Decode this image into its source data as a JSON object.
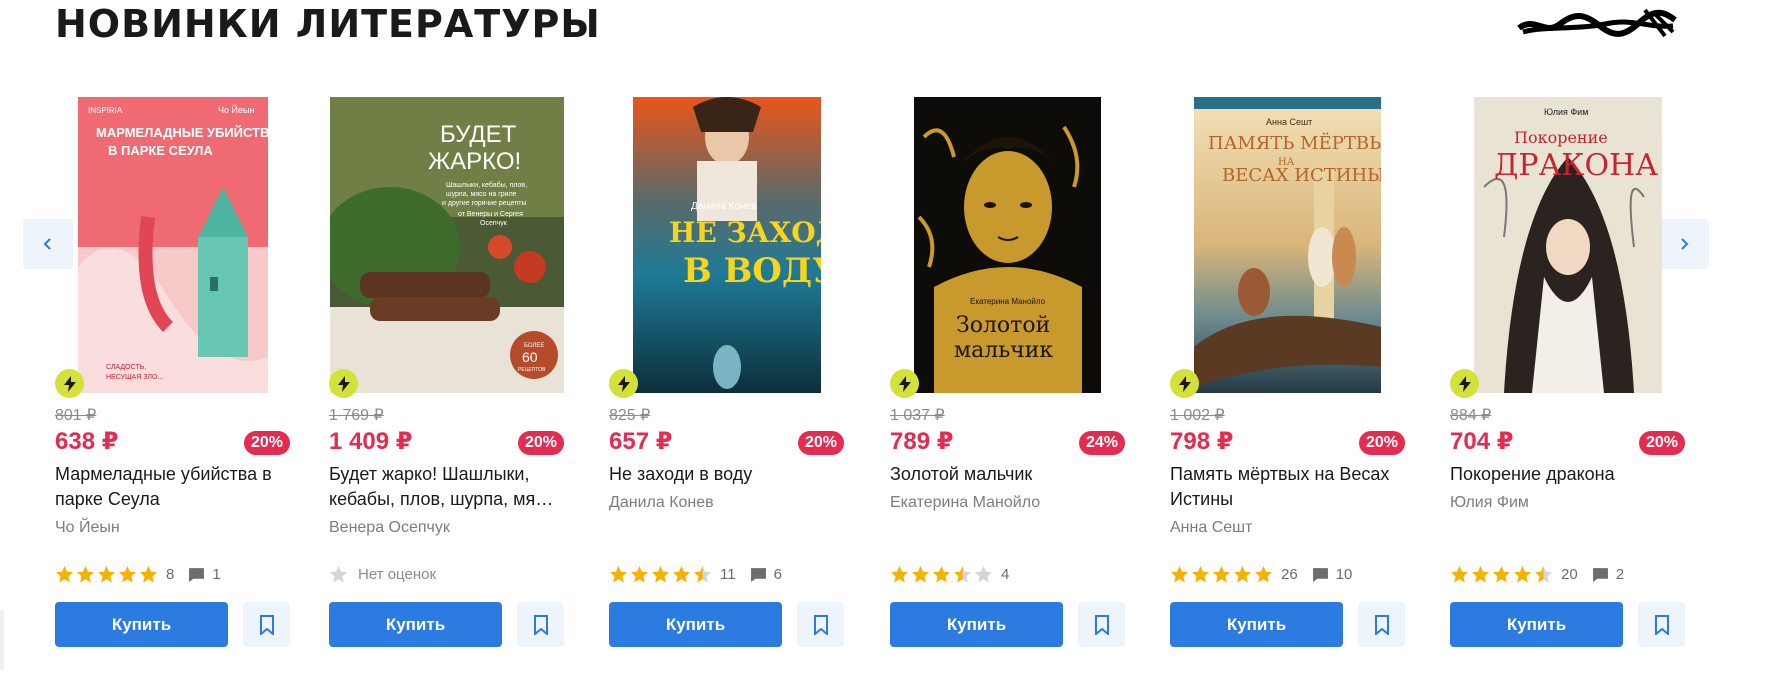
{
  "section": {
    "title": "НОВИНКИ ЛИТЕРАТУРЫ"
  },
  "colors": {
    "price": "#e52b50",
    "buy": "#2c7be0",
    "bolt": "#d3e13a",
    "star": "#f5b301"
  },
  "nav": {
    "prev_icon": "chevron-left-icon",
    "next_icon": "chevron-right-icon"
  },
  "books": [
    {
      "old_price": "801 ₽",
      "price": "638 ₽",
      "discount": "20%",
      "title": "Мармеладные убийства в парке Сеула",
      "author": "Чо Йеын",
      "stars": 5,
      "rating_count": "8",
      "comments": "1",
      "cover": {
        "brand": "INSPIRIA",
        "author": "Чо Йеын",
        "title1": "МАРМЕЛАДНЫЕ УБИЙСТВА",
        "title2": "В ПАРКЕ СЕУЛА",
        "tag1": "СЛАДОСТЬ,",
        "tag2": "НЕСУЩАЯ ЗЛО..."
      },
      "buy_label": "Купить"
    },
    {
      "old_price": "1 769 ₽",
      "price": "1 409 ₽",
      "discount": "20%",
      "title": "Будет жарко! Шашлыки, кебабы, плов, шурпа, мясо на гриле",
      "author": "Венера Осепчук",
      "stars": 0,
      "no_rating": "Нет оценок",
      "cover": {
        "title1": "БУДЕТ",
        "title2": "ЖАРКО!",
        "sub1": "Шашлыки, кебабы, плов,",
        "sub2": "шурпа, мясо на гриле",
        "sub3": "и другие горячие рецепты",
        "sub4": "от Венеры и Сергея",
        "sub5": "Осепчук",
        "badge1": "БОЛЕЕ",
        "badge2": "60",
        "badge3": "РЕЦЕПТОВ"
      },
      "buy_label": "Купить"
    },
    {
      "old_price": "825 ₽",
      "price": "657 ₽",
      "discount": "20%",
      "title": "Не заходи в воду",
      "author": "Данила Конев",
      "stars": 4.5,
      "rating_count": "11",
      "comments": "6",
      "cover": {
        "author": "Данила Конев",
        "title1": "НЕ ЗАХОДИ",
        "title2": "В ВОДУ"
      },
      "buy_label": "Купить"
    },
    {
      "old_price": "1 037 ₽",
      "price": "789 ₽",
      "discount": "24%",
      "title": "Золотой мальчик",
      "author": "Екатерина Манойло",
      "stars": 3.5,
      "rating_count": "4",
      "cover": {
        "author": "Екатерина Манойло",
        "title1": "Золотой",
        "title2": "мальчик"
      },
      "buy_label": "Купить"
    },
    {
      "old_price": "1 002 ₽",
      "price": "798 ₽",
      "discount": "20%",
      "title": "Память мёртвых на Весах Истины",
      "author": "Анна Сешт",
      "stars": 5,
      "rating_count": "26",
      "comments": "10",
      "cover": {
        "author": "Анна Сешт",
        "title1": "ПАМЯТЬ МЁРТВЫХ",
        "title2": "НА",
        "title3": "ВЕСАХ ИСТИНЫ"
      },
      "buy_label": "Купить"
    },
    {
      "old_price": "884 ₽",
      "price": "704 ₽",
      "discount": "20%",
      "title": "Покорение дракона",
      "author": "Юлия Фим",
      "stars": 4.5,
      "rating_count": "20",
      "comments": "2",
      "cover": {
        "author": "Юлия Фим",
        "title1": "Покорение",
        "title2": "ДРАКОНА"
      },
      "buy_label": "Купить"
    }
  ]
}
